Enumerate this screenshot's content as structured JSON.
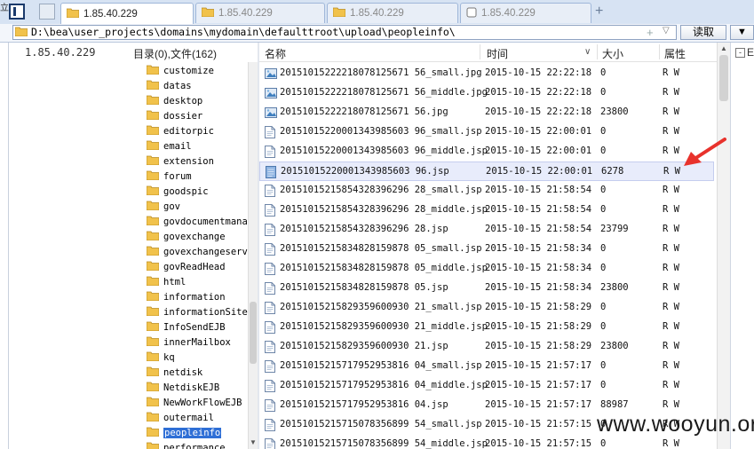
{
  "tabs": [
    {
      "label": "1.85.40.229",
      "active": true
    },
    {
      "label": "1.85.40.229",
      "active": false
    },
    {
      "label": "1.85.40.229",
      "active": false
    },
    {
      "label": "1.85.40.229",
      "active": false
    }
  ],
  "tab_add_label": "+",
  "left_edge_char": "立",
  "address": {
    "path": "D:\\bea\\user_projects\\domains\\mydomain\\defaulttroot\\upload\\peopleinfo\\",
    "plus": "+",
    "dropdown": "▽",
    "read_label": "读取",
    "right_btn_label": "▼"
  },
  "tree": {
    "host": "1.85.40.229",
    "stats": "目录(0),文件(162)",
    "folders": [
      "customize",
      "datas",
      "desktop",
      "dossier",
      "editorpic",
      "email",
      "extension",
      "forum",
      "goodspic",
      "gov",
      "govdocumentmana",
      "govexchange",
      "govexchangeserve",
      "govReadHead",
      "html",
      "information",
      "informationSite",
      "InfoSendEJB",
      "innerMailbox",
      "kq",
      "netdisk",
      "NetdiskEJB",
      "NewWorkFlowEJB",
      "outermail",
      "peopleinfo",
      "performance"
    ],
    "selected": "peopleinfo"
  },
  "list": {
    "headers": {
      "name": "名称",
      "time": "时间",
      "size": "大小",
      "attr": "属性"
    },
    "sort_indicator": "∨",
    "selected_index": 5,
    "rows": [
      {
        "name": "20151015222218078125671 56_small.jpg",
        "time": "2015-10-15 22:22:18",
        "size": "0",
        "attr": "R W",
        "icon": "image"
      },
      {
        "name": "20151015222218078125671 56_middle.jpg",
        "time": "2015-10-15 22:22:18",
        "size": "0",
        "attr": "R W",
        "icon": "image"
      },
      {
        "name": "20151015222218078125671 56.jpg",
        "time": "2015-10-15 22:22:18",
        "size": "23800",
        "attr": "R W",
        "icon": "image"
      },
      {
        "name": "20151015220001343985603 96_small.jsp",
        "time": "2015-10-15 22:00:01",
        "size": "0",
        "attr": "R W",
        "icon": "doc"
      },
      {
        "name": "20151015220001343985603 96_middle.jsp",
        "time": "2015-10-15 22:00:01",
        "size": "0",
        "attr": "R W",
        "icon": "doc"
      },
      {
        "name": "20151015220001343985603 96.jsp",
        "time": "2015-10-15 22:00:01",
        "size": "6278",
        "attr": "R W",
        "icon": "doc"
      },
      {
        "name": "20151015215854328396296 28_small.jsp",
        "time": "2015-10-15 21:58:54",
        "size": "0",
        "attr": "R W",
        "icon": "doc"
      },
      {
        "name": "20151015215854328396296 28_middle.jsp",
        "time": "2015-10-15 21:58:54",
        "size": "0",
        "attr": "R W",
        "icon": "doc"
      },
      {
        "name": "20151015215854328396296 28.jsp",
        "time": "2015-10-15 21:58:54",
        "size": "23799",
        "attr": "R W",
        "icon": "doc"
      },
      {
        "name": "20151015215834828159878 05_small.jsp",
        "time": "2015-10-15 21:58:34",
        "size": "0",
        "attr": "R W",
        "icon": "doc"
      },
      {
        "name": "20151015215834828159878 05_middle.jsp",
        "time": "2015-10-15 21:58:34",
        "size": "0",
        "attr": "R W",
        "icon": "doc"
      },
      {
        "name": "20151015215834828159878 05.jsp",
        "time": "2015-10-15 21:58:34",
        "size": "23800",
        "attr": "R W",
        "icon": "doc"
      },
      {
        "name": "20151015215829359600930 21_small.jsp",
        "time": "2015-10-15 21:58:29",
        "size": "0",
        "attr": "R W",
        "icon": "doc"
      },
      {
        "name": "20151015215829359600930 21_middle.jsp",
        "time": "2015-10-15 21:58:29",
        "size": "0",
        "attr": "R W",
        "icon": "doc"
      },
      {
        "name": "20151015215829359600930 21.jsp",
        "time": "2015-10-15 21:58:29",
        "size": "23800",
        "attr": "R W",
        "icon": "doc"
      },
      {
        "name": "20151015215717952953816 04_small.jsp",
        "time": "2015-10-15 21:57:17",
        "size": "0",
        "attr": "R W",
        "icon": "doc"
      },
      {
        "name": "20151015215717952953816 04_middle.jsp",
        "time": "2015-10-15 21:57:17",
        "size": "0",
        "attr": "R W",
        "icon": "doc"
      },
      {
        "name": "20151015215717952953816 04.jsp",
        "time": "2015-10-15 21:57:17",
        "size": "88987",
        "attr": "R W",
        "icon": "doc"
      },
      {
        "name": "20151015215715078356899 54_small.jsp",
        "time": "2015-10-15 21:57:15",
        "size": "0",
        "attr": "R W",
        "icon": "doc"
      },
      {
        "name": "20151015215715078356899 54_middle.jsp",
        "time": "2015-10-15 21:57:15",
        "size": "0",
        "attr": "R W",
        "icon": "doc"
      }
    ]
  },
  "right_panel": {
    "collapse": "-",
    "text": "E"
  },
  "watermark": "www.wooyun.org",
  "colors": {
    "selection": "#2f6fd6",
    "arrow": "#e8322c",
    "folder": "#f1c24b"
  }
}
